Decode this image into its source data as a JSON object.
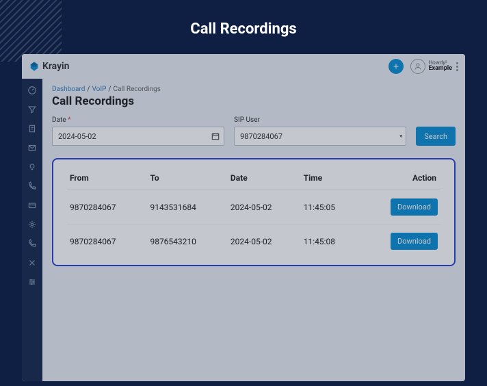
{
  "outer_title": "Call Recordings",
  "brand": "Krayin",
  "greeting": {
    "hi": "Howdy!",
    "name": "Example"
  },
  "breadcrumb": {
    "a": "Dashboard",
    "b": "VoIP",
    "c": "Call Recordings"
  },
  "page_heading": "Call Recordings",
  "filters": {
    "date_label": "Date",
    "date_value": "2024-05-02",
    "sip_label": "SIP User",
    "sip_value": "9870284067",
    "search_label": "Search"
  },
  "table": {
    "headers": {
      "from": "From",
      "to": "To",
      "date": "Date",
      "time": "Time",
      "action": "Action"
    },
    "rows": [
      {
        "from": "9870284067",
        "to": "9143531684",
        "date": "2024-05-02",
        "time": "11:45:05",
        "action": "Download"
      },
      {
        "from": "9870284067",
        "to": "9876543210",
        "date": "2024-05-02",
        "time": "11:45:08",
        "action": "Download"
      }
    ]
  }
}
